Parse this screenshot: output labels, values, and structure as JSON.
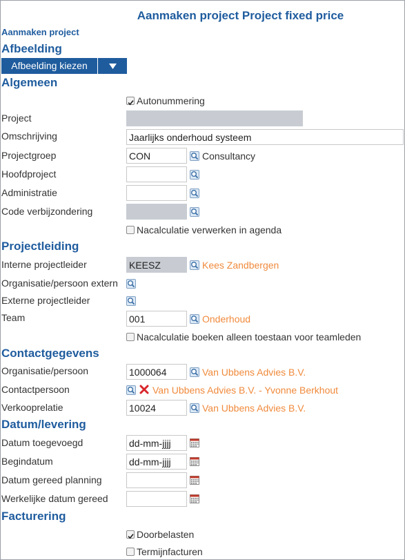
{
  "title": "Aanmaken project Project fixed price",
  "breadcrumb": "Aanmaken project",
  "sections": {
    "afbeelding": "Afbeelding",
    "algemeen": "Algemeen",
    "projectleiding": "Projectleiding",
    "contactgegevens": "Contactgegevens",
    "datum": "Datum/levering",
    "facturering": "Facturering"
  },
  "afbeelding": {
    "button_label": "Afbeelding kiezen"
  },
  "algemeen": {
    "autonummering": {
      "label": "Autonummering",
      "checked": true
    },
    "project": {
      "label": "Project",
      "value": ""
    },
    "omschrijving": {
      "label": "Omschrijving",
      "value": "Jaarlijks onderhoud systeem"
    },
    "projectgroep": {
      "label": "Projectgroep",
      "value": "CON",
      "desc": "Consultancy"
    },
    "hoofdproject": {
      "label": "Hoofdproject",
      "value": ""
    },
    "administratie": {
      "label": "Administratie",
      "value": ""
    },
    "code_verbijzondering": {
      "label": "Code verbijzondering",
      "value": ""
    },
    "nacalculatie_agenda": {
      "label": "Nacalculatie verwerken in agenda",
      "checked": false
    }
  },
  "projectleiding": {
    "interne_projectleider": {
      "label": "Interne projectleider",
      "value": "KEESZ",
      "desc": "Kees Zandbergen"
    },
    "organisatie_extern": {
      "label": "Organisatie/persoon extern"
    },
    "externe_projectleider": {
      "label": "Externe projectleider"
    },
    "team": {
      "label": "Team",
      "value": "001",
      "desc": "Onderhoud"
    },
    "nacalculatie_team": {
      "label": "Nacalculatie boeken alleen toestaan voor teamleden",
      "checked": false
    }
  },
  "contactgegevens": {
    "organisatie": {
      "label": "Organisatie/persoon",
      "value": "1000064",
      "desc": "Van Ubbens Advies B.V."
    },
    "contactpersoon": {
      "label": "Contactpersoon",
      "desc": "Van Ubbens Advies B.V. - Yvonne Berkhout"
    },
    "verkooprelatie": {
      "label": "Verkooprelatie",
      "value": "10024",
      "desc": "Van Ubbens Advies B.V."
    }
  },
  "datum": {
    "toegevoegd": {
      "label": "Datum toegevoegd",
      "value": "dd-mm-jjjj"
    },
    "begindatum": {
      "label": "Begindatum",
      "value": "dd-mm-jjjj"
    },
    "gereed_planning": {
      "label": "Datum gereed planning",
      "value": ""
    },
    "werkelijke_gereed": {
      "label": "Werkelijke datum gereed",
      "value": ""
    }
  },
  "facturering": {
    "doorbelasten": {
      "label": "Doorbelasten",
      "checked": true
    },
    "termijnfacturen": {
      "label": "Termijnfacturen",
      "checked": false
    }
  },
  "colors": {
    "accent": "#1f5c9e",
    "link": "#f08a3c",
    "disabled": "#c8ccd2",
    "delete": "#d9262c"
  }
}
